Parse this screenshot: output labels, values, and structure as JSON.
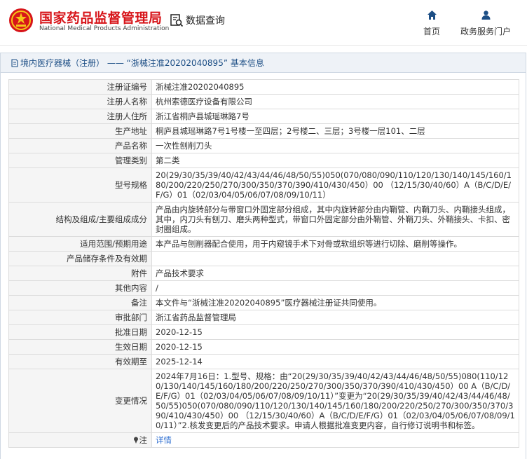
{
  "header": {
    "brand_cn": "国家药品监督管理局",
    "brand_en": "National Medical Products Administration",
    "query_label": "数据查询",
    "nav": {
      "home": "首页",
      "portal": "政务服务门户"
    },
    "accent_red": "#d7151a",
    "accent_blue": "#1c4e85"
  },
  "panel": {
    "title": "境内医疗器械（注册） —— “浙械注准20202040895” 基本信息"
  },
  "rows": [
    {
      "label": "注册证编号",
      "value": "浙械注准20202040895"
    },
    {
      "label": "注册人名称",
      "value": "杭州索德医疗设备有限公司"
    },
    {
      "label": "注册人住所",
      "value": "浙江省桐庐县城瑶琳路7号"
    },
    {
      "label": "生产地址",
      "value": "桐庐县城瑶琳路7号1号楼一至四层；2号楼二、三层；3号楼一层101、二层"
    },
    {
      "label": "产品名称",
      "value": "一次性刨削刀头"
    },
    {
      "label": "管理类别",
      "value": "第二类"
    },
    {
      "label": "型号规格",
      "value": "20(29/30/35/39/40/42/43/44/46/48/50/55)050(070/080/090/110/120/130/140/145/160/180/200/220/250/270/300/350/370/390/410/430/450）00 （12/15/30/40/60）A（B/C/D/E/F/G）01（02/03/04/05/06/07/08/09/10/11）"
    },
    {
      "label": "结构及组成/主要组成成分",
      "value": "产品由内旋转部分与带窗口外固定部分组成，其中内旋转部分由内鞘管、内鞘刀头、内鞘接头组成，其中，内刀头有刨刀、磨头两种型式，带窗口外固定部分由外鞘管、外鞘刀头、外鞘接头、卡扣、密封圈组成。"
    },
    {
      "label": "适用范围/预期用途",
      "value": "本产品与刨削器配合使用，用于内窥镜手术下对骨或软组织等进行切除、磨削等操作。"
    },
    {
      "label": "产品储存条件及有效期",
      "value": ""
    },
    {
      "label": "附件",
      "value": "产品技术要求"
    },
    {
      "label": "其他内容",
      "value": "/"
    },
    {
      "label": "备注",
      "value": "本文件与“浙械注准20202040895”医疗器械注册证共同使用。"
    },
    {
      "label": "审批部门",
      "value": "浙江省药品监督管理局"
    },
    {
      "label": "批准日期",
      "value": "2020-12-15"
    },
    {
      "label": "生效日期",
      "value": "2020-12-15"
    },
    {
      "label": "有效期至",
      "value": "2025-12-14"
    },
    {
      "label": "变更情况",
      "value": "2024年7月16日：1.型号、规格：由“20(29/30/35/39/40/42/43/44/46/48/50/55)080(110/120/130/140/145/160/180/200/220/250/270/300/350/370/390/410/430/450）00 A（B/C/D/E/F/G）01（02/03/04/05/06/07/08/09/10/11）”变更为“20(29/30/35/39/40/42/43/44/46/48/50/55)050(070/080/090/110/120/130/140/145/160/180/200/220/250/270/300/350/370/390/410/430/450）00 （12/15/30/40/60）A（B/C/D/E/F/G）01（02/03/04/05/06/07/08/09/10/11）”2.核发变更后的产品技术要求。申请人根据批准变更内容，自行修订说明书和标签。"
    }
  ],
  "note": {
    "label": "注",
    "link": "详情"
  }
}
